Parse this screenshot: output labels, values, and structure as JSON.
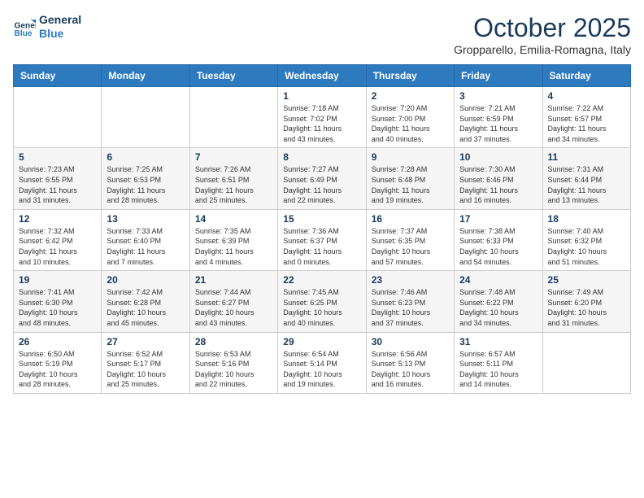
{
  "header": {
    "logo_line1": "General",
    "logo_line2": "Blue",
    "month": "October 2025",
    "location": "Gropparello, Emilia-Romagna, Italy"
  },
  "days_of_week": [
    "Sunday",
    "Monday",
    "Tuesday",
    "Wednesday",
    "Thursday",
    "Friday",
    "Saturday"
  ],
  "weeks": [
    [
      {
        "day": "",
        "content": ""
      },
      {
        "day": "",
        "content": ""
      },
      {
        "day": "",
        "content": ""
      },
      {
        "day": "1",
        "content": "Sunrise: 7:18 AM\nSunset: 7:02 PM\nDaylight: 11 hours\nand 43 minutes."
      },
      {
        "day": "2",
        "content": "Sunrise: 7:20 AM\nSunset: 7:00 PM\nDaylight: 11 hours\nand 40 minutes."
      },
      {
        "day": "3",
        "content": "Sunrise: 7:21 AM\nSunset: 6:59 PM\nDaylight: 11 hours\nand 37 minutes."
      },
      {
        "day": "4",
        "content": "Sunrise: 7:22 AM\nSunset: 6:57 PM\nDaylight: 11 hours\nand 34 minutes."
      }
    ],
    [
      {
        "day": "5",
        "content": "Sunrise: 7:23 AM\nSunset: 6:55 PM\nDaylight: 11 hours\nand 31 minutes."
      },
      {
        "day": "6",
        "content": "Sunrise: 7:25 AM\nSunset: 6:53 PM\nDaylight: 11 hours\nand 28 minutes."
      },
      {
        "day": "7",
        "content": "Sunrise: 7:26 AM\nSunset: 6:51 PM\nDaylight: 11 hours\nand 25 minutes."
      },
      {
        "day": "8",
        "content": "Sunrise: 7:27 AM\nSunset: 6:49 PM\nDaylight: 11 hours\nand 22 minutes."
      },
      {
        "day": "9",
        "content": "Sunrise: 7:28 AM\nSunset: 6:48 PM\nDaylight: 11 hours\nand 19 minutes."
      },
      {
        "day": "10",
        "content": "Sunrise: 7:30 AM\nSunset: 6:46 PM\nDaylight: 11 hours\nand 16 minutes."
      },
      {
        "day": "11",
        "content": "Sunrise: 7:31 AM\nSunset: 6:44 PM\nDaylight: 11 hours\nand 13 minutes."
      }
    ],
    [
      {
        "day": "12",
        "content": "Sunrise: 7:32 AM\nSunset: 6:42 PM\nDaylight: 11 hours\nand 10 minutes."
      },
      {
        "day": "13",
        "content": "Sunrise: 7:33 AM\nSunset: 6:40 PM\nDaylight: 11 hours\nand 7 minutes."
      },
      {
        "day": "14",
        "content": "Sunrise: 7:35 AM\nSunset: 6:39 PM\nDaylight: 11 hours\nand 4 minutes."
      },
      {
        "day": "15",
        "content": "Sunrise: 7:36 AM\nSunset: 6:37 PM\nDaylight: 11 hours\nand 0 minutes."
      },
      {
        "day": "16",
        "content": "Sunrise: 7:37 AM\nSunset: 6:35 PM\nDaylight: 10 hours\nand 57 minutes."
      },
      {
        "day": "17",
        "content": "Sunrise: 7:38 AM\nSunset: 6:33 PM\nDaylight: 10 hours\nand 54 minutes."
      },
      {
        "day": "18",
        "content": "Sunrise: 7:40 AM\nSunset: 6:32 PM\nDaylight: 10 hours\nand 51 minutes."
      }
    ],
    [
      {
        "day": "19",
        "content": "Sunrise: 7:41 AM\nSunset: 6:30 PM\nDaylight: 10 hours\nand 48 minutes."
      },
      {
        "day": "20",
        "content": "Sunrise: 7:42 AM\nSunset: 6:28 PM\nDaylight: 10 hours\nand 45 minutes."
      },
      {
        "day": "21",
        "content": "Sunrise: 7:44 AM\nSunset: 6:27 PM\nDaylight: 10 hours\nand 43 minutes."
      },
      {
        "day": "22",
        "content": "Sunrise: 7:45 AM\nSunset: 6:25 PM\nDaylight: 10 hours\nand 40 minutes."
      },
      {
        "day": "23",
        "content": "Sunrise: 7:46 AM\nSunset: 6:23 PM\nDaylight: 10 hours\nand 37 minutes."
      },
      {
        "day": "24",
        "content": "Sunrise: 7:48 AM\nSunset: 6:22 PM\nDaylight: 10 hours\nand 34 minutes."
      },
      {
        "day": "25",
        "content": "Sunrise: 7:49 AM\nSunset: 6:20 PM\nDaylight: 10 hours\nand 31 minutes."
      }
    ],
    [
      {
        "day": "26",
        "content": "Sunrise: 6:50 AM\nSunset: 5:19 PM\nDaylight: 10 hours\nand 28 minutes."
      },
      {
        "day": "27",
        "content": "Sunrise: 6:52 AM\nSunset: 5:17 PM\nDaylight: 10 hours\nand 25 minutes."
      },
      {
        "day": "28",
        "content": "Sunrise: 6:53 AM\nSunset: 5:16 PM\nDaylight: 10 hours\nand 22 minutes."
      },
      {
        "day": "29",
        "content": "Sunrise: 6:54 AM\nSunset: 5:14 PM\nDaylight: 10 hours\nand 19 minutes."
      },
      {
        "day": "30",
        "content": "Sunrise: 6:56 AM\nSunset: 5:13 PM\nDaylight: 10 hours\nand 16 minutes."
      },
      {
        "day": "31",
        "content": "Sunrise: 6:57 AM\nSunset: 5:11 PM\nDaylight: 10 hours\nand 14 minutes."
      },
      {
        "day": "",
        "content": ""
      }
    ]
  ]
}
